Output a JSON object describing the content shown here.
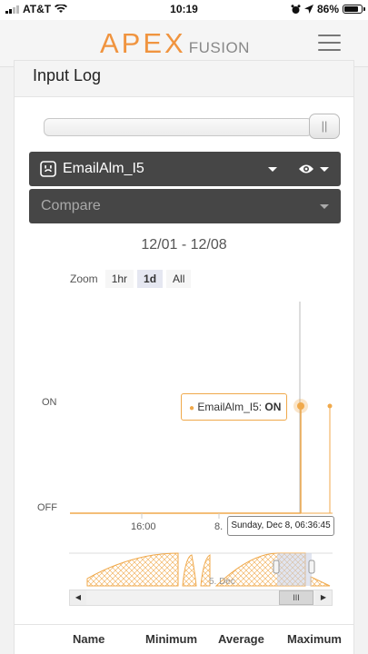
{
  "status_bar": {
    "carrier": "AT&T",
    "time": "10:19",
    "battery": "86%",
    "battery_level": 0.86
  },
  "header": {
    "logo_main": "APEX",
    "logo_sub": "FUSION",
    "accent_color": "#f0943f",
    "menu_icon": "hamburger-menu-icon"
  },
  "panel": {
    "title": "Input Log",
    "output_select": {
      "value": "EmailAlm_I5",
      "icon": "outlet-icon"
    },
    "visibility_icon": "eye-icon",
    "compare_select": {
      "placeholder": "Compare"
    },
    "date_range": "12/01 - 12/08",
    "zoom": {
      "label": "Zoom",
      "options": [
        "1hr",
        "1d",
        "All"
      ],
      "selected": "1d"
    }
  },
  "chart_data": {
    "type": "line",
    "series": [
      {
        "name": "EmailAlm_I5",
        "color": "#f0a94b"
      }
    ],
    "y_categories": [
      "OFF",
      "ON"
    ],
    "x_tick_labels": [
      "16:00",
      "8."
    ],
    "navigator_label": "5. Dec",
    "tooltip": {
      "series": "EmailAlm_I5",
      "value": "ON"
    },
    "crosshair_label": "Sunday, Dec 8, 06:36:45",
    "grid": true
  },
  "scrollbar": {
    "thumb_label": "III"
  },
  "table": {
    "columns": [
      "Name",
      "Minimum",
      "Average",
      "Maximum"
    ]
  }
}
